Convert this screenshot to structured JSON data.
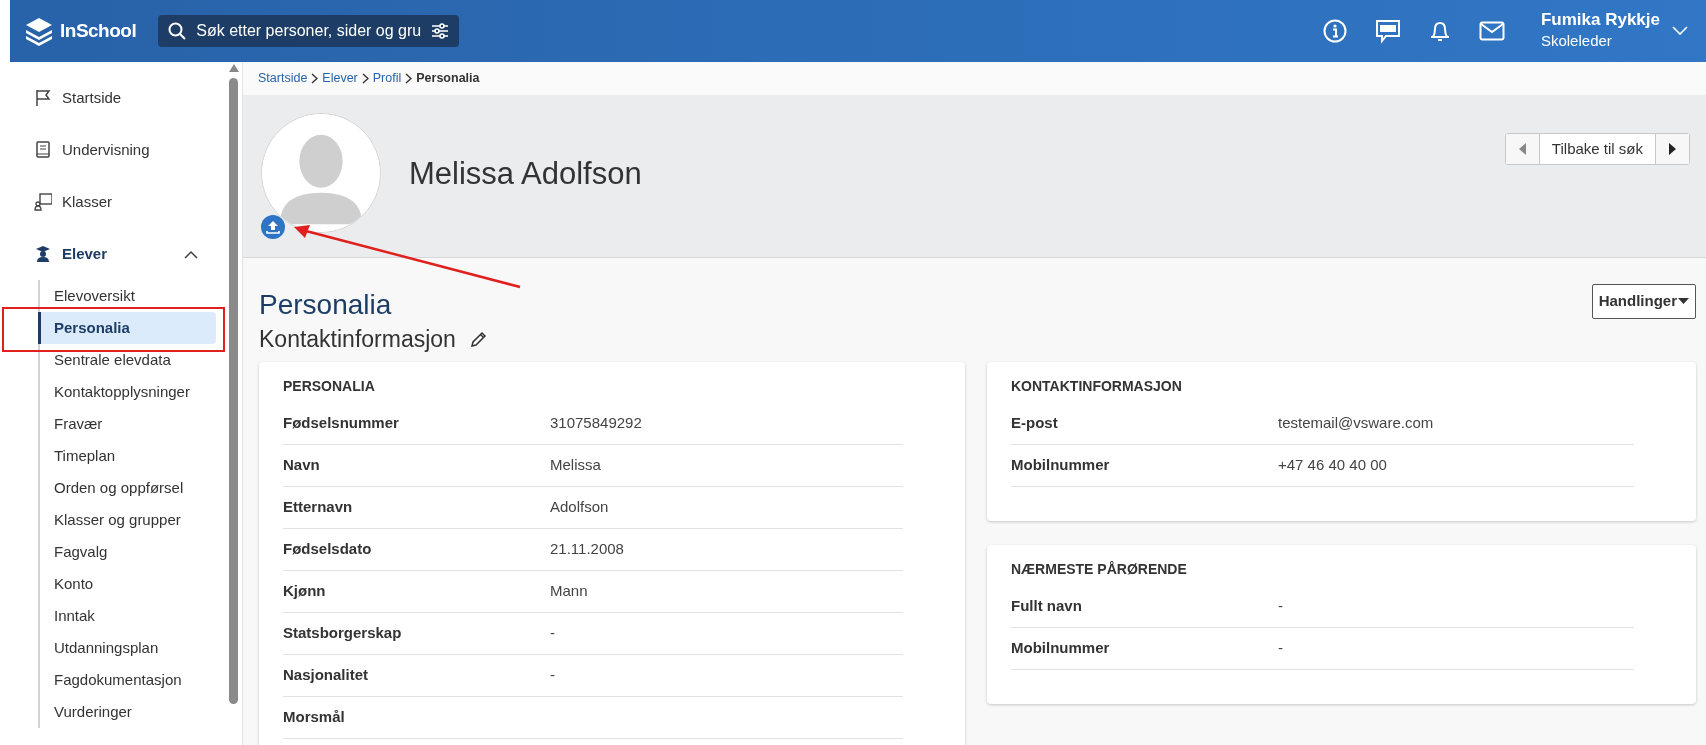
{
  "header": {
    "logo": "InSchool",
    "search": {
      "placeholder": "Søk etter personer, sider og gru"
    },
    "user": {
      "name": "Fumika Rykkje",
      "role": "Skoleleder"
    }
  },
  "sidebar": {
    "items": [
      {
        "label": "Startside"
      },
      {
        "label": "Undervisning"
      },
      {
        "label": "Klasser"
      },
      {
        "label": "Elever",
        "expanded": true,
        "children": [
          {
            "label": "Elevoversikt",
            "selected": false
          },
          {
            "label": "Personalia",
            "selected": true
          },
          {
            "label": "Sentrale elevdata",
            "selected": false
          },
          {
            "label": "Kontaktopplysninger",
            "selected": false
          },
          {
            "label": "Fravær",
            "selected": false
          },
          {
            "label": "Timeplan",
            "selected": false
          },
          {
            "label": "Orden og oppførsel",
            "selected": false
          },
          {
            "label": "Klasser og grupper",
            "selected": false
          },
          {
            "label": "Fagvalg",
            "selected": false
          },
          {
            "label": "Konto",
            "selected": false
          },
          {
            "label": "Inntak",
            "selected": false
          },
          {
            "label": "Utdanningsplan",
            "selected": false
          },
          {
            "label": "Fagdokumentasjon",
            "selected": false
          },
          {
            "label": "Vurderinger",
            "selected": false
          }
        ]
      }
    ]
  },
  "breadcrumb": [
    {
      "label": "Startside",
      "current": false
    },
    {
      "label": "Elever",
      "current": false
    },
    {
      "label": "Profil",
      "current": false
    },
    {
      "label": "Personalia",
      "current": true
    }
  ],
  "profile": {
    "name": "Melissa Adolfson",
    "navigation": {
      "prev": {
        "disabled": true
      },
      "label": "Tilbake til søk",
      "next": {
        "disabled": false
      }
    }
  },
  "page_title": "Personalia",
  "actions_button": "Handlinger",
  "section_title": "Kontaktinformasjon",
  "left_cards": [
    {
      "title": "PERSONALIA",
      "rows": [
        {
          "label": "Fødselsnummer",
          "value": "31075849292"
        },
        {
          "label": "Navn",
          "value": "Melissa"
        },
        {
          "label": "Etternavn",
          "value": "Adolfson"
        },
        {
          "label": "Fødselsdato",
          "value": "21.11.2008"
        },
        {
          "label": "Kjønn",
          "value": "Mann"
        },
        {
          "label": "Statsborgerskap",
          "value": "-"
        },
        {
          "label": "Nasjonalitet",
          "value": "-"
        },
        {
          "label": "Morsmål"
        }
      ]
    }
  ],
  "right_cards": [
    {
      "title": "KONTAKTINFORMASJON",
      "rows": [
        {
          "label": "E-post",
          "value": "testemail@vsware.com"
        },
        {
          "label": "Mobilnummer",
          "value": "+47 46 40 40 00"
        }
      ]
    },
    {
      "title": "NÆRMESTE PÅRØRENDE",
      "rows": [
        {
          "label": "Fullt navn",
          "value": "-"
        },
        {
          "label": "Mobilnummer",
          "value": "-"
        }
      ]
    }
  ]
}
